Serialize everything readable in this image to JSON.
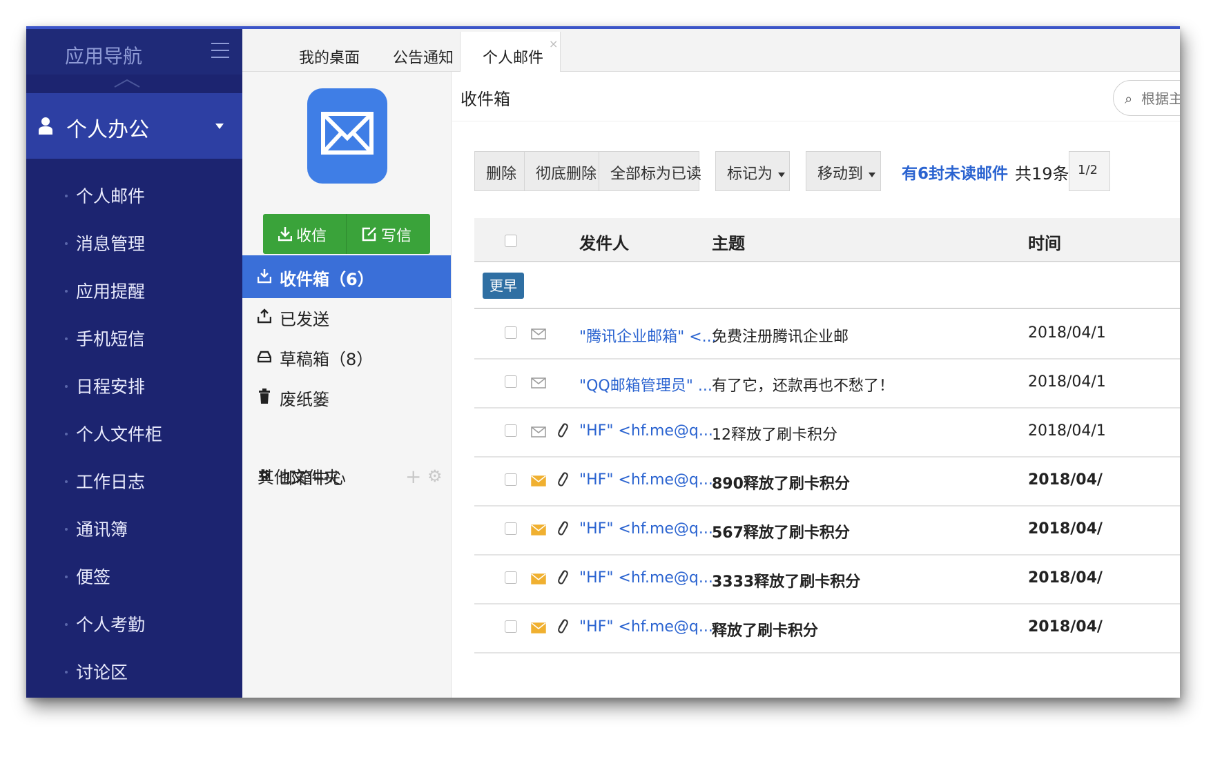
{
  "nav": {
    "title": "应用导航",
    "group": "个人办公",
    "items": [
      "个人邮件",
      "消息管理",
      "应用提醒",
      "手机短信",
      "日程安排",
      "个人文件柜",
      "工作日志",
      "通讯簿",
      "便签",
      "个人考勤",
      "讨论区"
    ]
  },
  "tabs": [
    {
      "label": "我的桌面"
    },
    {
      "label": "公告通知"
    },
    {
      "label": "个人邮件",
      "close": "×"
    }
  ],
  "mail_panel": {
    "receive": "收信",
    "write": "写信",
    "folders": [
      "收件箱（6）",
      "已发送",
      "草稿箱（8）",
      "废纸篓"
    ],
    "other_folders": "其他文件夹",
    "mail_center": "邮箱中心"
  },
  "main": {
    "title": "收件箱",
    "search_placeholder": "根据主题",
    "toolbar": {
      "delete": "删除",
      "purge": "彻底删除",
      "mark_all_read": "全部标为已读",
      "mark_as": "标记为",
      "move_to": "移动到"
    },
    "unread_notice": "有6封未读邮件",
    "total": "共19条",
    "page": "1/2",
    "columns": {
      "sender": "发件人",
      "subject": "主题",
      "time": "时间"
    },
    "group_label": "更早",
    "rows": [
      {
        "sender": "\"腾讯企业邮箱\" <...",
        "subject": "免费注册腾讯企业邮",
        "time": "2018/04/1",
        "read": true,
        "attachment": false
      },
      {
        "sender": "\"QQ邮箱管理员\" ...",
        "subject": "有了它，还款再也不愁了！",
        "time": "2018/04/1",
        "read": true,
        "attachment": false
      },
      {
        "sender": "\"HF\" <hf.me@q...",
        "subject": "12释放了刷卡积分",
        "time": "2018/04/1",
        "read": true,
        "attachment": true
      },
      {
        "sender": "\"HF\" <hf.me@q...",
        "subject": "890释放了刷卡积分",
        "time": "2018/04/",
        "read": false,
        "attachment": true
      },
      {
        "sender": "\"HF\" <hf.me@q...",
        "subject": "567释放了刷卡积分",
        "time": "2018/04/",
        "read": false,
        "attachment": true
      },
      {
        "sender": "\"HF\" <hf.me@q...",
        "subject": "3333释放了刷卡积分",
        "time": "2018/04/",
        "read": false,
        "attachment": true
      },
      {
        "sender": "\"HF\" <hf.me@q...",
        "subject": "释放了刷卡积分",
        "time": "2018/04/",
        "read": false,
        "attachment": true
      }
    ]
  },
  "colors": {
    "nav_bg": "#1c2470",
    "nav_group_bg": "#2d3fa3",
    "accent": "#3a6fd8",
    "write_button": "#3aa33a",
    "link": "#2a63d0",
    "unread_envelope": "#f0b030"
  }
}
